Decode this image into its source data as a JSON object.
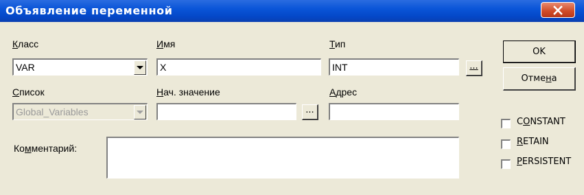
{
  "window": {
    "title": "Объявление переменной",
    "close_glyph": "X",
    "close_icon": "close-icon"
  },
  "class": {
    "label_key": "К",
    "label_rest": "ласс",
    "value": "VAR"
  },
  "name": {
    "label_key": "И",
    "label_rest": "мя",
    "value": "X"
  },
  "type": {
    "label_key": "Т",
    "label_rest": "ип",
    "value": "INT",
    "browse_label": "..."
  },
  "list": {
    "label_key": "С",
    "label_rest": "писок",
    "value": "Global_Variables"
  },
  "initial_value": {
    "label_key": "Н",
    "label_rest": "ач. значение",
    "value": "",
    "browse_label": "..."
  },
  "address": {
    "label_key": "А",
    "label_rest": "дрес",
    "value": ""
  },
  "comment": {
    "label_pre": "Ко",
    "label_key": "м",
    "label_rest": "ментарий:",
    "value": ""
  },
  "buttons": {
    "ok": "OK",
    "cancel_pre": "Отме",
    "cancel_key": "н",
    "cancel_rest": "а"
  },
  "flags": [
    {
      "pre": "C",
      "key": "O",
      "rest": "NSTANT",
      "checked": false
    },
    {
      "pre": "",
      "key": "R",
      "rest": "ETAIN",
      "checked": false
    },
    {
      "pre": "",
      "key": "P",
      "rest": "ERSISTENT",
      "checked": false
    }
  ]
}
